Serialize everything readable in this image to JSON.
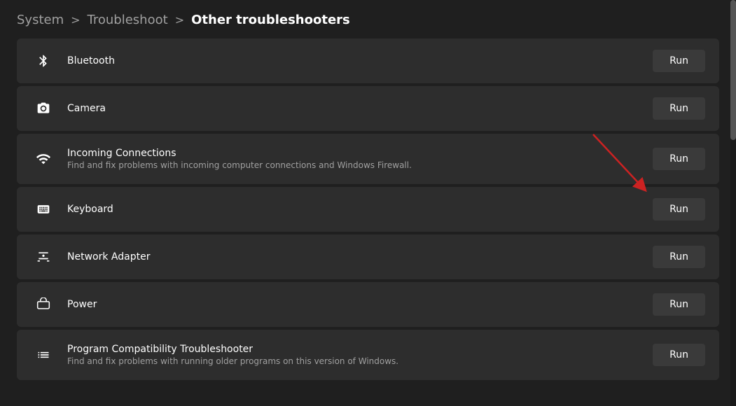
{
  "breadcrumb": {
    "system": "System",
    "separator1": ">",
    "troubleshoot": "Troubleshoot",
    "separator2": ">",
    "current": "Other troubleshooters"
  },
  "items": [
    {
      "id": "bluetooth",
      "title": "Bluetooth",
      "description": "",
      "icon": "bluetooth",
      "button_label": "Run"
    },
    {
      "id": "camera",
      "title": "Camera",
      "description": "",
      "icon": "camera",
      "button_label": "Run"
    },
    {
      "id": "incoming-connections",
      "title": "Incoming Connections",
      "description": "Find and fix problems with incoming computer connections and Windows Firewall.",
      "icon": "wifi",
      "button_label": "Run"
    },
    {
      "id": "keyboard",
      "title": "Keyboard",
      "description": "",
      "icon": "keyboard",
      "button_label": "Run"
    },
    {
      "id": "network-adapter",
      "title": "Network Adapter",
      "description": "",
      "icon": "network",
      "button_label": "Run"
    },
    {
      "id": "power",
      "title": "Power",
      "description": "",
      "icon": "power",
      "button_label": "Run"
    },
    {
      "id": "program-compatibility",
      "title": "Program Compatibility Troubleshooter",
      "description": "Find and fix problems with running older programs on this version of Windows.",
      "icon": "list",
      "button_label": "Run"
    }
  ]
}
